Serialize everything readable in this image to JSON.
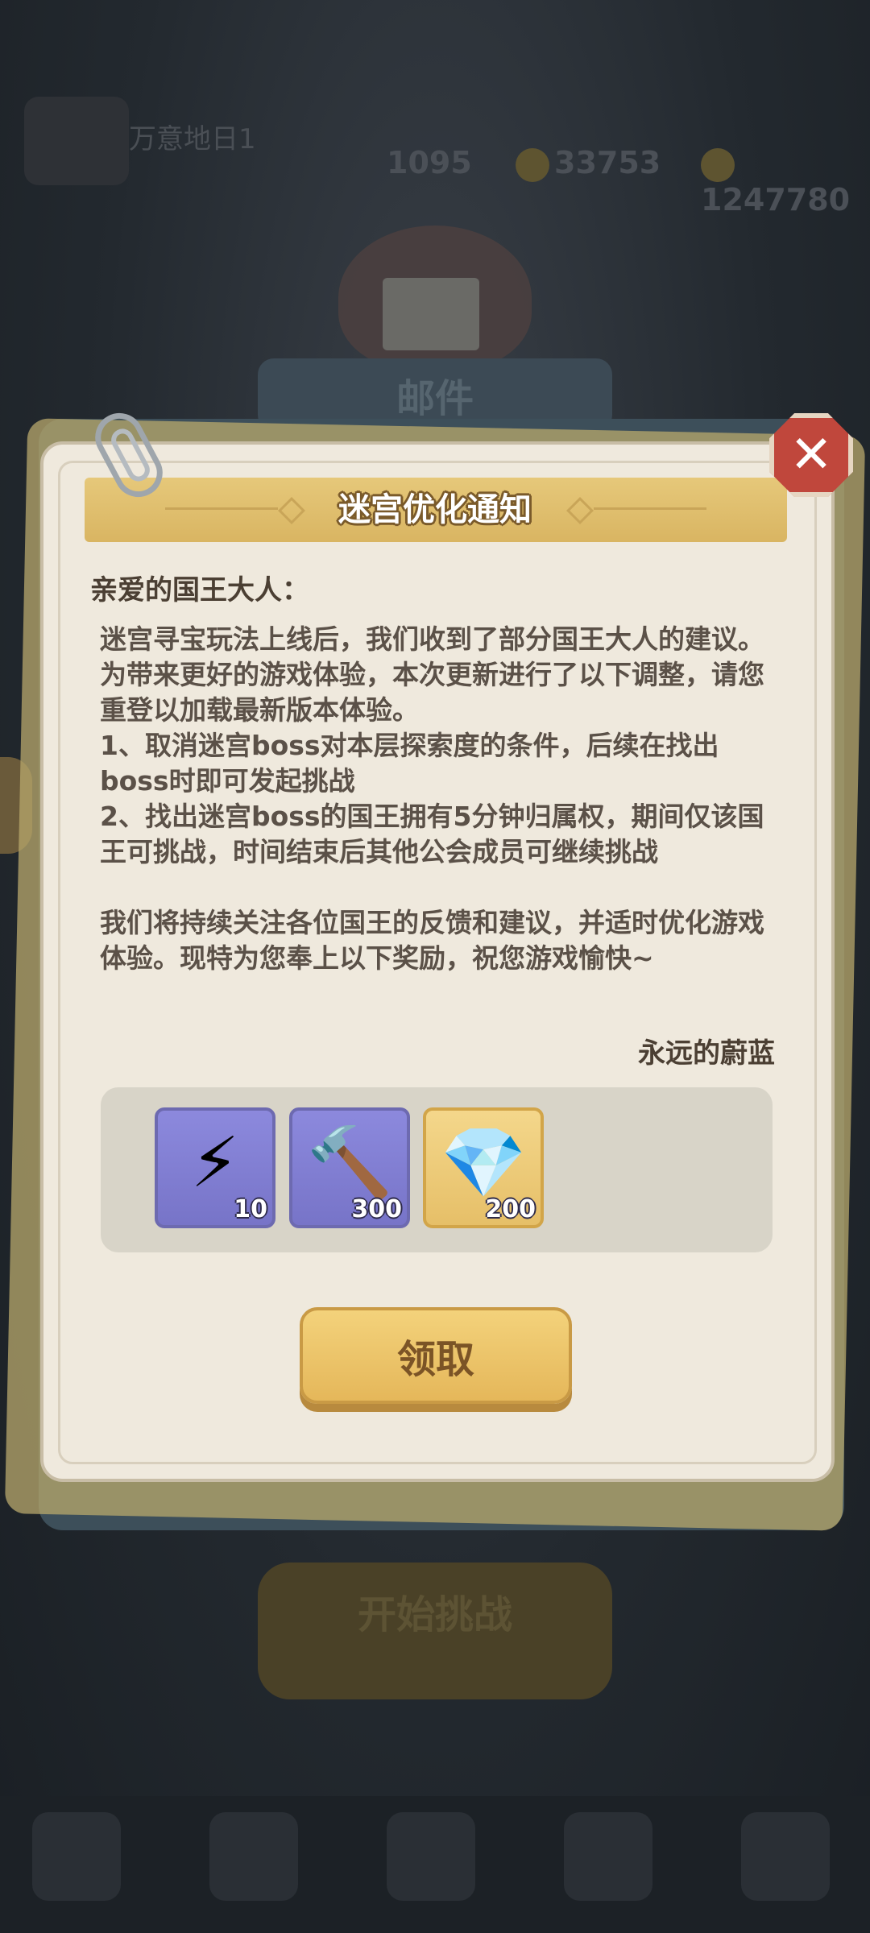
{
  "background": {
    "player_name": "万意地日1",
    "resources": [
      "1095",
      "33753",
      "1247780"
    ],
    "mail_title": "邮件",
    "bottom_button": "开始挑战"
  },
  "dialog": {
    "title": "迷宫优化通知",
    "greeting": "亲爱的国王大人：",
    "paragraphs": [
      "迷宫寻宝玩法上线后，我们收到了部分国王大人的建议。为带来更好的游戏体验，本次更新进行了以下调整，请您重登以加载最新版本体验。",
      "1、取消迷宫boss对本层探索度的条件，后续在找出boss时即可发起挑战",
      "2、找出迷宫boss的国王拥有5分钟归属权，期间仅该国王可挑战，时间结束后其他公会成员可继续挑战",
      "我们将持续关注各位国王的反馈和建议，并适时优化游戏体验。现特为您奉上以下奖励，祝您游戏愉快~"
    ],
    "signature": "永远的蔚蓝",
    "rewards": [
      {
        "icon": "lightning-icon",
        "glyph": "⚡",
        "count": "10"
      },
      {
        "icon": "chisel-icon",
        "glyph": "🔨",
        "count": "300"
      },
      {
        "icon": "diamond-icon",
        "glyph": "💎",
        "count": "200"
      }
    ],
    "claim_label": "领取",
    "close_glyph": "✕"
  },
  "colors": {
    "banner_gold": "#d9b562",
    "close_red": "#c0473c",
    "paper": "#efe9dd"
  }
}
